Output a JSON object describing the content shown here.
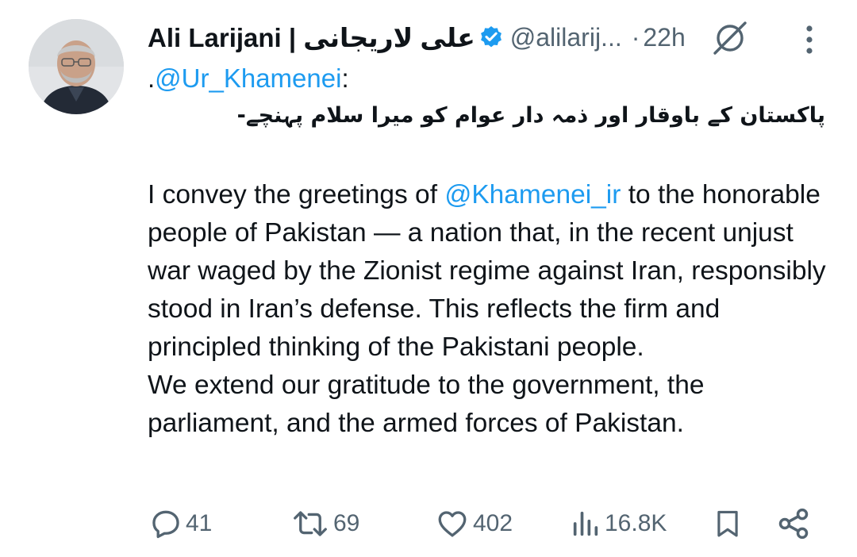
{
  "author": {
    "display_name": "Ali Larijani | علی لاریجانی",
    "handle": "@alilarij...",
    "separator": "·",
    "time": "22h"
  },
  "reply": {
    "prefix": ".",
    "mention": "@Ur_Khamenei",
    "suffix": ":"
  },
  "urdu_text": "پاکستان کے باوقار اور ذمہ دار عوام کو میرا سلام پہنچے-",
  "body": {
    "line1_before": "I convey the greetings of ",
    "line1_mention": "@Khamenei_ir",
    "line1_after": " to the honorable people of Pakistan — a nation that, in the recent unjust war waged by the Zionist regime against Iran, responsibly stood in Iran’s defense. This reflects the firm and principled thinking of the Pakistani people.",
    "line2": "We extend our gratitude to the government, the parliament, and the armed forces of Pakistan."
  },
  "actions": {
    "replies": "41",
    "reposts": "69",
    "likes": "402",
    "views": "16.8K"
  },
  "icons": {
    "verified": "verified-badge-icon",
    "grok": "grok-icon",
    "more": "more-vertical-icon",
    "reply": "reply-icon",
    "repost": "repost-icon",
    "like": "heart-icon",
    "views": "views-icon",
    "bookmark": "bookmark-icon",
    "share": "share-icon"
  },
  "colors": {
    "accent": "#1d9bf0",
    "text": "#0f1419",
    "muted": "#536471"
  }
}
